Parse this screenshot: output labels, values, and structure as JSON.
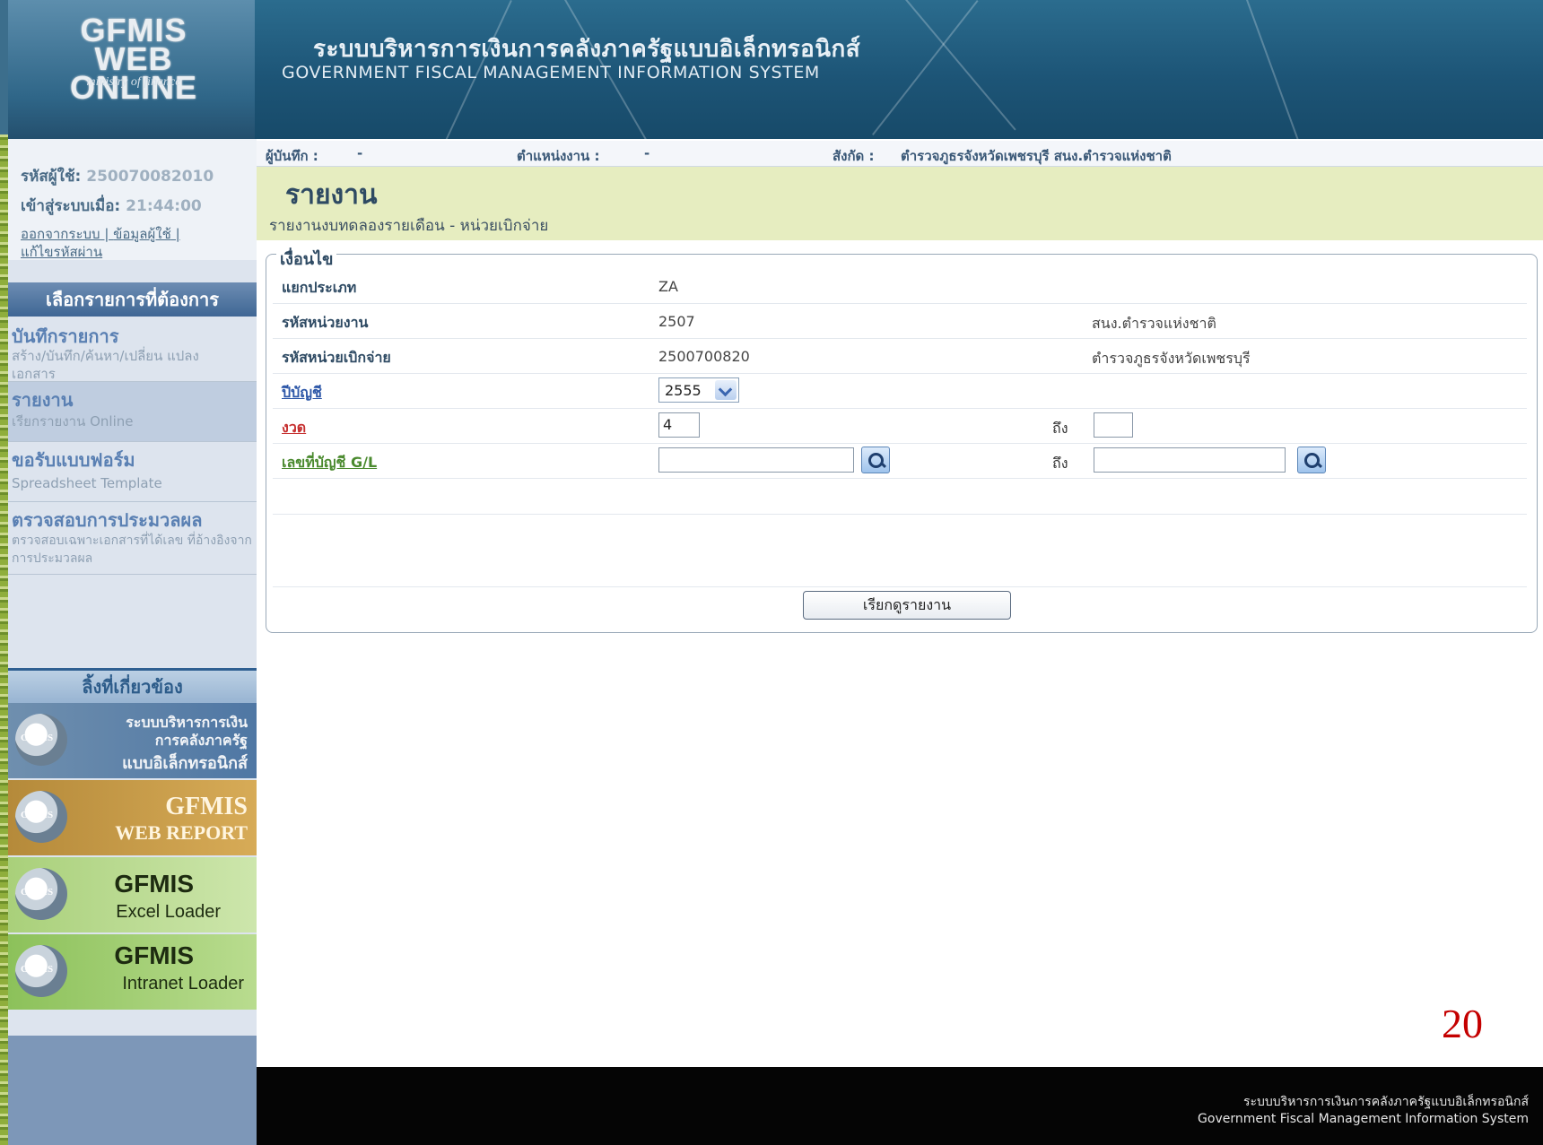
{
  "header": {
    "logo_main": "GFMIS",
    "logo_line2": "WEB ONLINE",
    "logo_sub": "ministry of finance",
    "title_th": "ระบบบริหารการเงินการคลังภาครัฐแบบอิเล็กทรอนิกส์",
    "title_en": "GOVERNMENT FISCAL MANAGEMENT INFORMATION SYSTEM"
  },
  "user": {
    "id_label": "รหัสผู้ใช้:",
    "id_value": "250070082010",
    "login_label": "เข้าสู่ระบบเมื่อ:",
    "login_value": "21:44:00",
    "logout": "ออกจากระบบ",
    "profile": "ข้อมูลผู้ใช้",
    "change_password": "แก้ไขรหัสผ่าน"
  },
  "sidebar": {
    "heading": "เลือกรายการที่ต้องการ",
    "items": [
      {
        "title": "บันทึกรายการ",
        "sub": "สร้าง/บันทึก/ค้นหา/เปลี่ยน แปลง เอกสาร"
      },
      {
        "title": "รายงาน",
        "sub": "เรียกรายงาน Online"
      },
      {
        "title": "ขอรับแบบฟอร์ม",
        "sub": "Spreadsheet Template"
      },
      {
        "title": "ตรวจสอบการประมวลผล",
        "sub": "ตรวจสอบเฉพาะเอกสารที่ได้เลข ที่อ้างอิงจากการประมวลผล"
      }
    ],
    "related_heading": "ลิ้งที่เกี่ยวข้อง",
    "banners": [
      {
        "icon": "GFMIS",
        "line1": "ระบบบริหารการเงิน",
        "line2": "การคลังภาครัฐ",
        "line3": "แบบอิเล็กทรอนิกส์"
      },
      {
        "icon": "GFMIS",
        "line1": "GFMIS",
        "line2": "WEB REPORT"
      },
      {
        "icon": "GFMIS",
        "line1": "GFMIS",
        "line2": "Excel Loader"
      },
      {
        "icon": "GFMIS",
        "line1": "GFMIS",
        "line2": "Intranet Loader"
      }
    ]
  },
  "infobar": {
    "recorder_label": "ผู้บันทึก :",
    "recorder_value": "-",
    "position_label": "ตำแหน่งงาน :",
    "position_value": "-",
    "affiliation_label": "สังกัด :",
    "affiliation_value": "ตำรวจภูธรจังหวัดเพชรบุรี สนง.ตำรวจแห่งชาติ"
  },
  "page": {
    "title": "รายงาน",
    "subtitle": "รายงานงบทดลองรายเดือน - หน่วยเบิกจ่าย"
  },
  "form": {
    "legend": "เงื่อนไข",
    "category_label": "แยกประเภท",
    "category_value": "ZA",
    "dept_label": "รหัสหน่วยงาน",
    "dept_code": "2507",
    "dept_name": "สนง.ตำรวจแห่งชาติ",
    "disb_label": "รหัสหน่วยเบิกจ่าย",
    "disb_code": "2500700820",
    "disb_name": "ตำรวจภูธรจังหวัดเพชรบุรี",
    "year_label": "ปีบัญชี",
    "year_value": "2555",
    "period_label": "งวด",
    "period_from": "4",
    "period_to_label": "ถึง",
    "period_to": "",
    "gl_label": "เลขที่บัญชี G/L",
    "gl_from": "",
    "gl_to_label": "ถึง",
    "gl_to": "",
    "run_button": "เรียกดูรายงาน"
  },
  "slide_number": "20",
  "footer": {
    "line1": "ระบบบริหารการเงินการคลังภาครัฐแบบอิเล็กทรอนิกส์",
    "line2": "Government Fiscal Management Information System"
  }
}
